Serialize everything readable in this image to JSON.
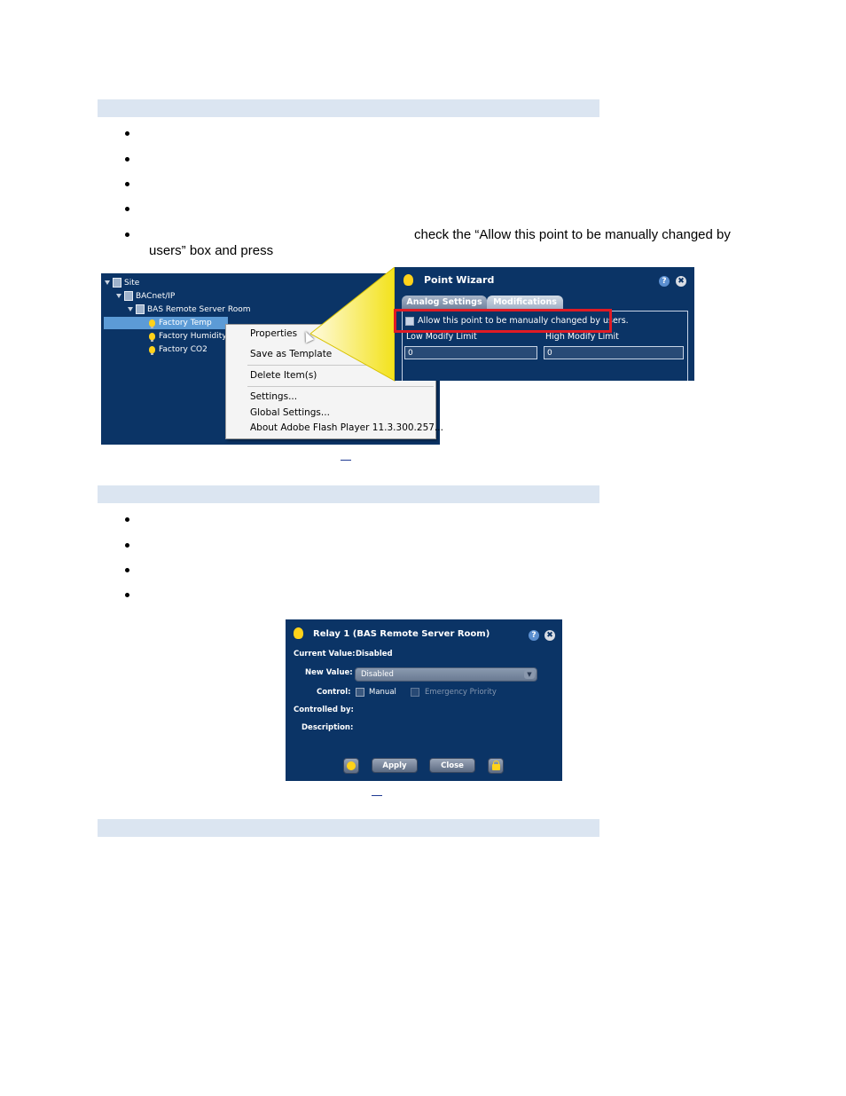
{
  "section1": {
    "bullet5_part1": "check the “Allow this point to be manually changed by",
    "bullet5_part2": "users” box and press"
  },
  "tree": {
    "items": [
      "Site",
      "BACnet/IP",
      "BAS Remote Server Room",
      "Factory Temp",
      "Factory Humidity",
      "Factory CO2"
    ]
  },
  "context_menu": {
    "items": [
      "Properties",
      "Save as Template",
      "Delete Item(s)",
      "Settings...",
      "Global Settings...",
      "About Adobe Flash Player 11.3.300.257..."
    ]
  },
  "wizard": {
    "title": "Point Wizard",
    "help_glyph": "?",
    "close_glyph": "✖",
    "tabs": [
      "Analog Settings",
      "Modifications"
    ],
    "allow_label": "Allow this point to be manually changed by users.",
    "low_label": "Low Modify Limit",
    "high_label": "High Modify Limit",
    "low_value": "0",
    "high_value": "0"
  },
  "relay": {
    "title": "Relay 1 (BAS Remote Server Room)",
    "help_glyph": "?",
    "close_glyph": "✖",
    "current_value_label": "Current Value:",
    "current_value": "Disabled",
    "new_value_label": "New Value:",
    "new_value": "Disabled",
    "control_label": "Control:",
    "manual_label": "Manual",
    "emergency_label": "Emergency Priority",
    "controlled_by_label": "Controlled by:",
    "description_label": "Description:",
    "apply_label": "Apply",
    "close_label": "Close"
  },
  "colors": {
    "header_bar": "#dbe5f1",
    "panel_bg": "#0b3466",
    "highlight_red": "#e01b24",
    "tree_selection": "#5c9bd6"
  }
}
